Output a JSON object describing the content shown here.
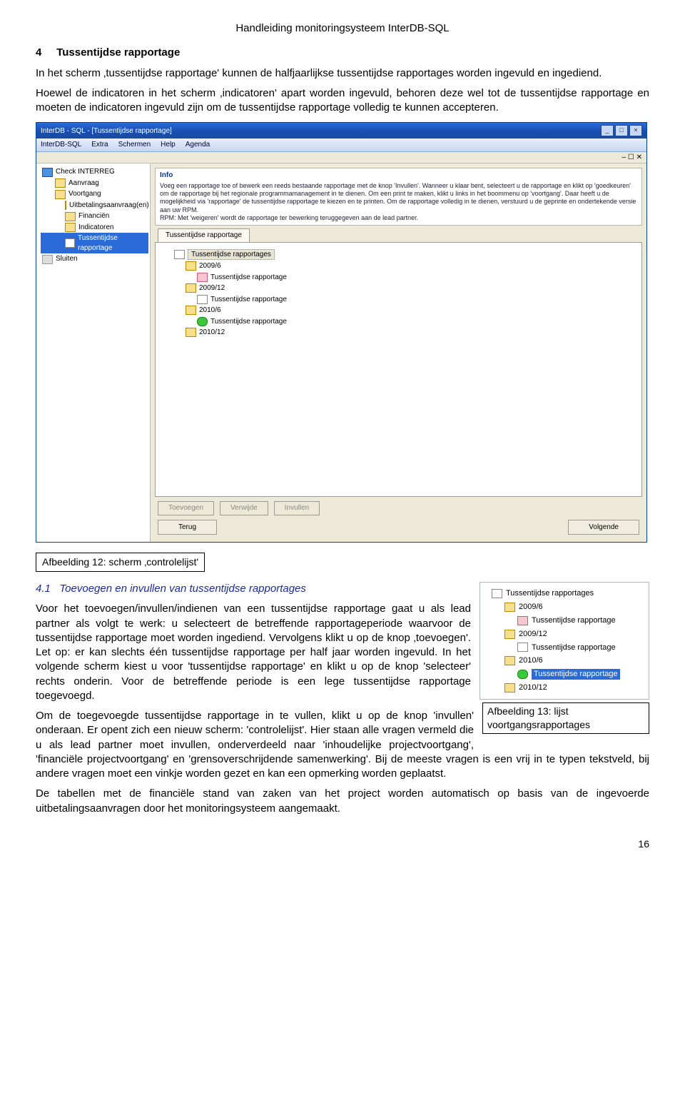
{
  "doc": {
    "header": "Handleiding monitoringsysteem InterDB-SQL",
    "section_num": "4",
    "section_title": "Tussentijdse rapportage",
    "para1": "In het scherm ‚tussentijdse rapportage' kunnen de halfjaarlijkse tussentijdse rapportages worden ingevuld en ingediend.",
    "para2": "Hoewel de indicatoren in het scherm ‚indicatoren' apart worden ingevuld, behoren deze wel tot de tussentijdse rapportage en moeten de indicatoren ingevuld zijn om de tussentijdse rapportage volledig te kunnen accepteren.",
    "caption12": "Afbeelding 12: scherm ‚controlelijst'",
    "sub_num": "4.1",
    "sub_title": "Toevoegen en invullen van tussentijdse rapportages",
    "para3a": "Voor het toevoegen/invullen/indienen van een tussentijdse rapportage gaat u als lead partner als volgt te werk: u selecteert de betreffende rapportageperiode waarvoor de tussentijdse rapportage moet worden ingediend. Vervolgens klikt u op de knop ‚toevoegen'. Let op: er kan slechts één tussentijdse rapportage per half jaar worden ingevuld. In het volgende scherm kiest u voor 'tussentijdse rapportage' en klikt u op de knop 'selecteer' rechts onderin. Voor de betreffende periode is een lege tussentijdse rapportage toegevoegd.",
    "para3b": "Om de toegevoegde tussentijdse rapportage in te vullen, klikt u op de knop 'invullen' onderaan. Er opent zich een nieuw scherm: 'controlelijst'. Hier staan alle vragen vermeld die u als lead partner moet invullen, onderverdeeld naar 'inhoudelijke projectvoortgang', 'financiële projectvoortgang' en 'grensoverschrijdende samenwerking'. Bij de meeste vragen is een vrij in te typen tekstveld, bij andere vragen moet een vinkje worden gezet en kan een opmerking worden geplaatst.",
    "para4": "De tabellen met de financiële stand van zaken van het project worden automatisch op basis van de ingevoerde uitbetalingsaanvragen door het monitoringsysteem aangemaakt.",
    "caption13": "Afbeelding 13: lijst voortgangsrapportages",
    "pagenum": "16"
  },
  "app": {
    "title": "InterDB - SQL - [Tussentijdse rapportage]",
    "menu": [
      "InterDB-SQL",
      "Extra",
      "Schermen",
      "Help",
      "Agenda"
    ],
    "subbar": "– ☐ ✕",
    "side": {
      "root": "Check INTERREG",
      "items": [
        "Aanvraag",
        "Voortgang"
      ],
      "sub": [
        "Uitbetalingsaanvraag(en)",
        "Financiën",
        "Indicatoren",
        "Tussentijdse rapportage"
      ],
      "close": "Sluiten"
    },
    "info_label": "Info",
    "info_line1": "Voeg een rapportage toe of bewerk een reeds bestaande rapportage met de knop 'Invullen'. Wanneer u klaar bent, selecteert u de rapportage en klikt op 'goedkeuren' om de rapportage bij het regionale programmamanagement in te dienen. Om een print te maken, klikt u links in het boommenu op 'voortgang'. Daar heeft u de mogelijkheid via 'rapportage' de tussentijdse rapportage te kiezen en te printen. Om de rapportage volledig in te dienen, verstuurd u de geprinte en ondertekende versie aan uw RPM.",
    "info_line2": "RPM: Met 'weigeren' wordt de rapportage ter bewerking teruggegeven aan de lead partner.",
    "tab": "Tussentijdse rapportage",
    "tree": {
      "root": "Tussentijdse rapportages",
      "p1": "2009/6",
      "p1a": "Tussentijdse rapportage",
      "p2": "2009/12",
      "p2a": "Tussentijdse rapportage",
      "p3": "2010/6",
      "p3a": "Tussentijdse rapportage",
      "p4": "2010/12"
    },
    "btns": {
      "add": "Toevoegen",
      "del": "Verwijde",
      "fill": "Invullen"
    },
    "nav": {
      "back": "Terug",
      "next": "Volgende"
    }
  },
  "mini": {
    "root": "Tussentijdse rapportages",
    "p1": "2009/6",
    "p1a": "Tussentijdse rapportage",
    "p2": "2009/12",
    "p2a": "Tussentijdse rapportage",
    "p3": "2010/6",
    "p3a": "Tussentijdse rapportage",
    "p4": "2010/12"
  }
}
